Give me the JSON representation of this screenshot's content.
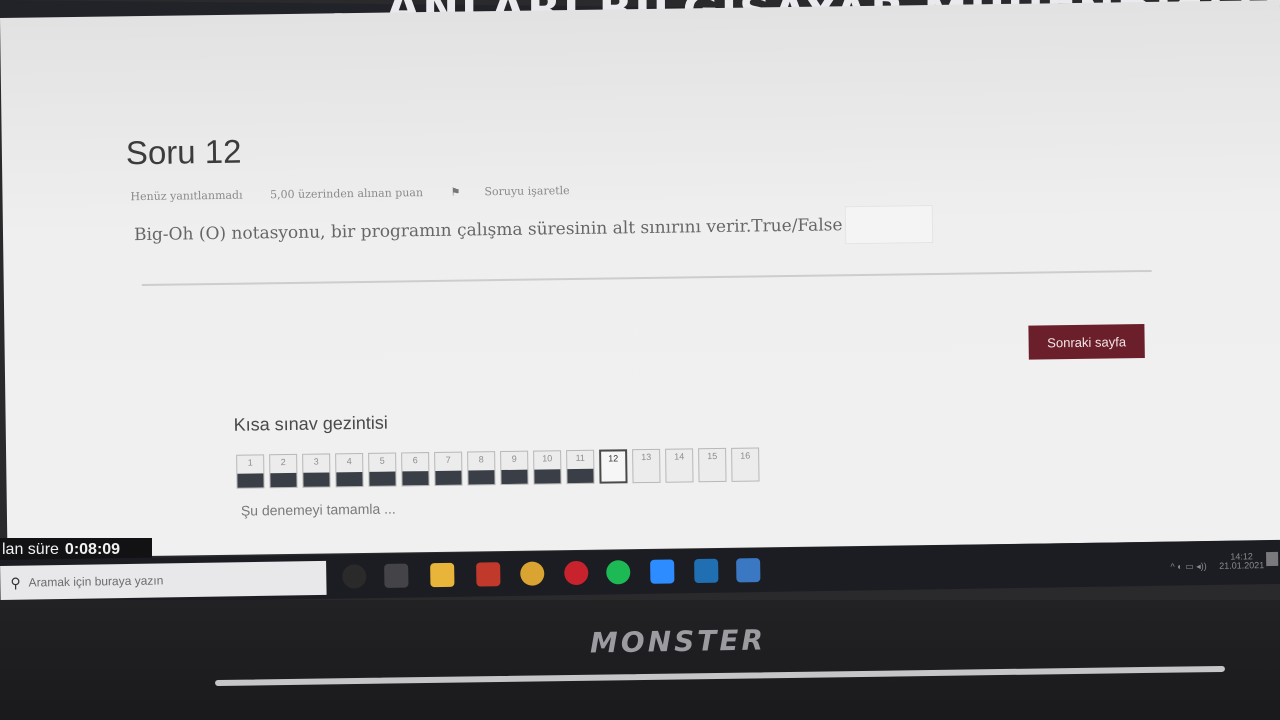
{
  "header": {
    "title": "...ANLARI BİLGİSAYAR MÜHENDİSLİĞİ"
  },
  "question": {
    "title": "Soru 12",
    "status": "Henüz yanıtlanmadı",
    "points": "5,00 üzerinden alınan puan",
    "flag_label": "Soruyu işaretle",
    "text": "Big-Oh (O) notasyonu, bir programın çalışma süresinin alt sınırını verir.True/False",
    "answer_value": ""
  },
  "buttons": {
    "next": "Sonraki sayfa"
  },
  "navigation": {
    "title": "Kısa sınav gezintisi",
    "items": [
      {
        "n": "1",
        "state": "answered"
      },
      {
        "n": "2",
        "state": "answered"
      },
      {
        "n": "3",
        "state": "answered"
      },
      {
        "n": "4",
        "state": "answered"
      },
      {
        "n": "5",
        "state": "answered"
      },
      {
        "n": "6",
        "state": "answered"
      },
      {
        "n": "7",
        "state": "answered"
      },
      {
        "n": "8",
        "state": "answered"
      },
      {
        "n": "9",
        "state": "answered"
      },
      {
        "n": "10",
        "state": "answered"
      },
      {
        "n": "11",
        "state": "answered"
      },
      {
        "n": "12",
        "state": "current"
      },
      {
        "n": "13",
        "state": "empty"
      },
      {
        "n": "14",
        "state": "empty"
      },
      {
        "n": "15",
        "state": "empty"
      },
      {
        "n": "16",
        "state": "empty"
      }
    ],
    "finish": "Şu denemeyi tamamla ..."
  },
  "timer": {
    "label": "lan süre",
    "value": "0:08:09"
  },
  "taskbar": {
    "search_placeholder": "Aramak için buraya yazın",
    "icons": [
      {
        "name": "cortana-icon",
        "color": "#2a2a2a"
      },
      {
        "name": "task-view-icon",
        "color": "#444448"
      },
      {
        "name": "file-explorer-icon",
        "color": "#e8b53a"
      },
      {
        "name": "game-app-icon",
        "color": "#c0392b"
      },
      {
        "name": "chrome-icon",
        "color": "#d9a431"
      },
      {
        "name": "pinterest-icon",
        "color": "#c8232c"
      },
      {
        "name": "spotify-icon",
        "color": "#1db954"
      },
      {
        "name": "zoom-icon",
        "color": "#2d8cff"
      },
      {
        "name": "app-icon",
        "color": "#1f6fb2"
      },
      {
        "name": "window-icon",
        "color": "#3a78c4"
      }
    ],
    "clock_time": "14:12",
    "clock_date": "21.01.2021"
  },
  "device": {
    "brand": "MONSTER"
  }
}
